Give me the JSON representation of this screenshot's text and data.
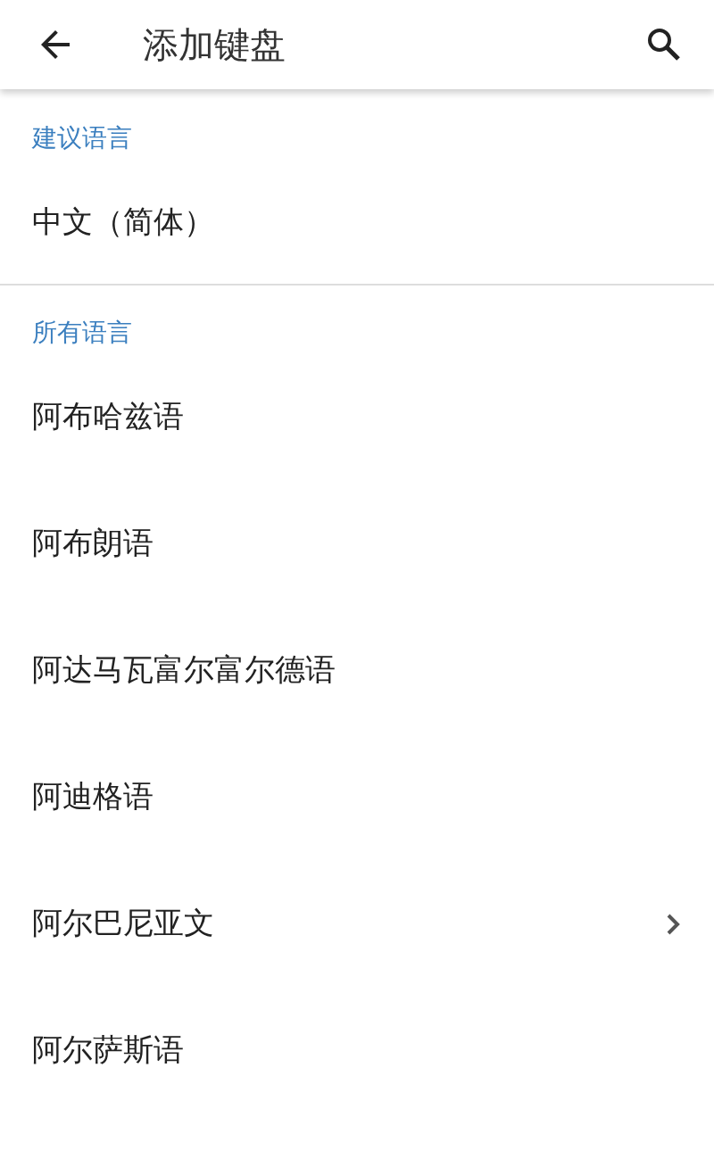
{
  "app_bar": {
    "title": "添加键盘"
  },
  "sections": [
    {
      "header": "建议语言",
      "items": [
        {
          "label": "中文（简体）",
          "has_submenu": false
        }
      ]
    },
    {
      "header": "所有语言",
      "items": [
        {
          "label": "阿布哈兹语",
          "has_submenu": false
        },
        {
          "label": "阿布朗语",
          "has_submenu": false
        },
        {
          "label": "阿达马瓦富尔富尔德语",
          "has_submenu": false
        },
        {
          "label": "阿迪格语",
          "has_submenu": false
        },
        {
          "label": "阿尔巴尼亚文",
          "has_submenu": true
        },
        {
          "label": "阿尔萨斯语",
          "has_submenu": false
        }
      ]
    }
  ]
}
